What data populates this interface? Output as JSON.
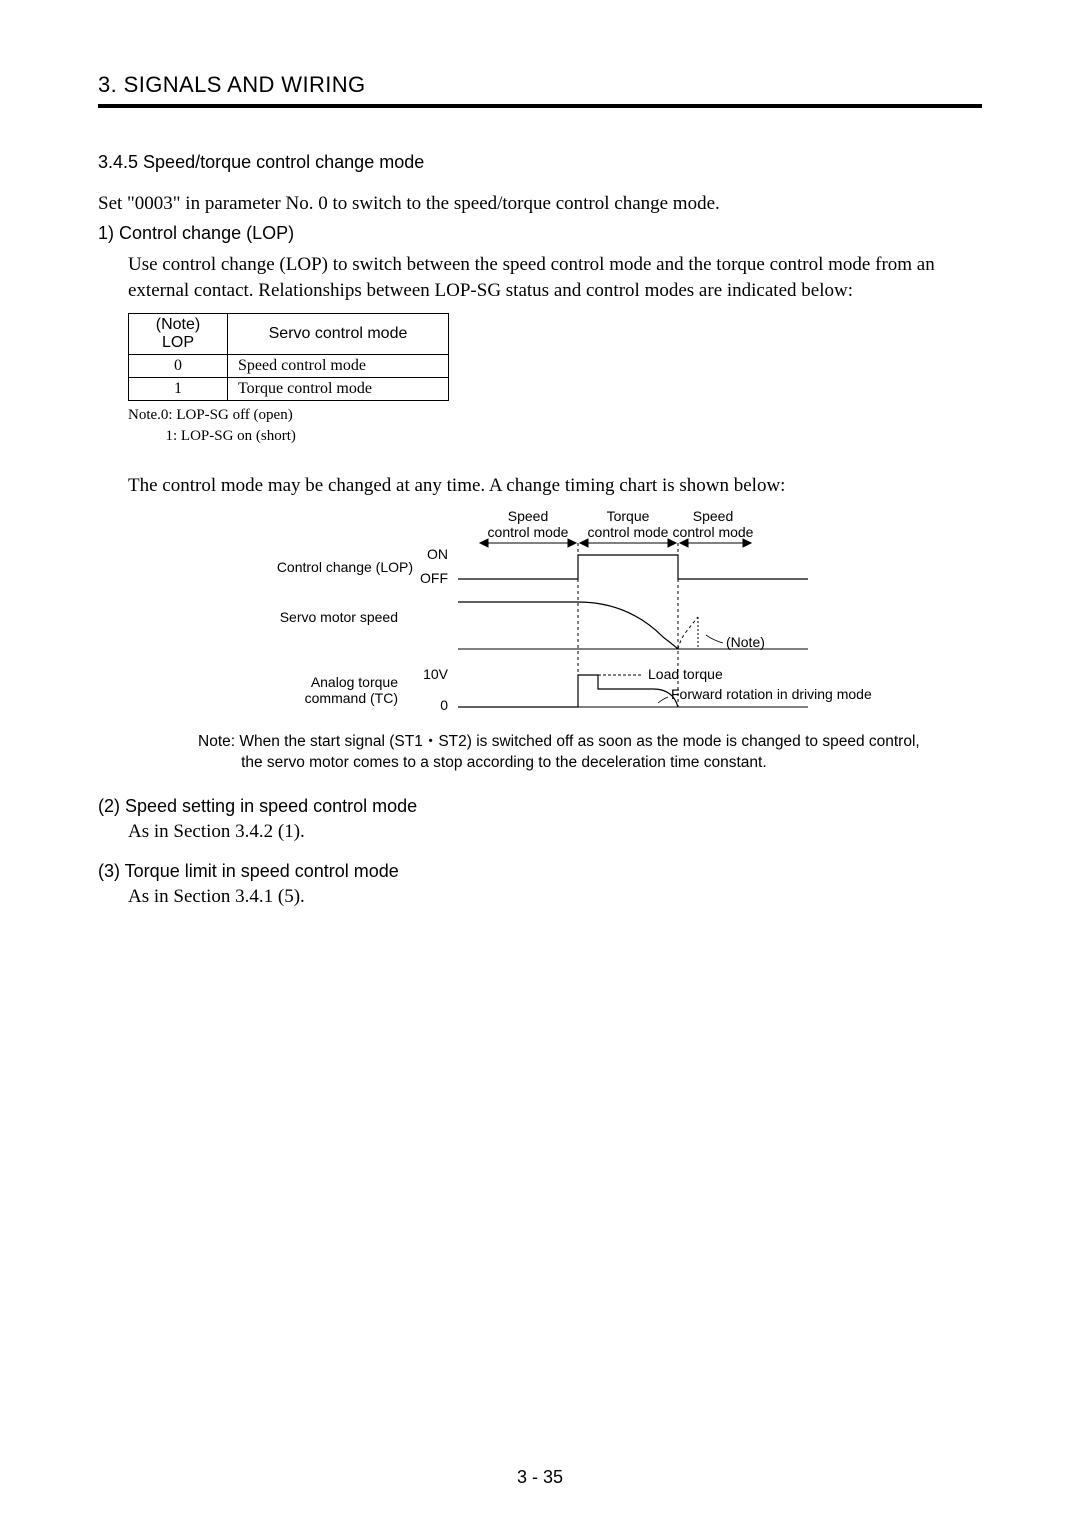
{
  "chapter_title": "3.  SIGNALS AND WIRING",
  "sec_no": "3.4.5 Speed/torque control change mode",
  "para_set": "Set \"0003\" in parameter No. 0 to switch to the speed/torque control change mode.",
  "sub1_title": "1) Control change (LOP)",
  "sub1_body": "Use control change (LOP) to switch between the speed control mode and the torque control mode from an external contact. Relationships between LOP-SG status and control modes are indicated below:",
  "table": {
    "h1": "(Note) LOP",
    "h2": "Servo control mode",
    "rows": [
      {
        "c0": "0",
        "c1": "Speed control mode"
      },
      {
        "c0": "1",
        "c1": "Torque control mode"
      }
    ],
    "note_line1": "Note.0: LOP-SG off (open)",
    "note_line2": "1: LOP-SG on (short)"
  },
  "para_change": "The control mode may be changed at any time. A change timing chart is shown below:",
  "chart": {
    "top_speed1": "Speed",
    "top_torque": "Torque",
    "top_speed2": "Speed",
    "top_cm1": "control mode",
    "top_cm2": "control mode",
    "top_cm3": "control mode",
    "lop_label": "Control change (LOP)",
    "on": "ON",
    "off": "OFF",
    "servo_label": "Servo motor speed",
    "note_label": "(Note)",
    "analog1": "Analog torque",
    "analog2": "command (TC)",
    "ten_v": "10V",
    "zero": "0",
    "load": "Load torque",
    "forward": "Forward rotation in driving mode"
  },
  "chart_note_line1": "Note: When the start signal (ST1・ST2) is switched off as soon as the mode is changed to speed control,",
  "chart_note_line2": "the servo motor comes to a stop according to the deceleration time constant.",
  "sub2_title": "(2) Speed setting in speed control mode",
  "sub2_body": "As in Section 3.4.2 (1).",
  "sub3_title": "(3) Torque limit in speed control mode",
  "sub3_body": "As in Section 3.4.1 (5).",
  "page_num": "3 -  35",
  "chart_data": {
    "type": "timing-diagram",
    "title": "Speed/torque control change timing chart",
    "signals": [
      {
        "name": "Control change (LOP)",
        "type": "digital",
        "levels": [
          "OFF",
          "ON"
        ],
        "segments": [
          {
            "phase": "Speed control mode",
            "level": "OFF"
          },
          {
            "phase": "Torque control mode",
            "level": "ON"
          },
          {
            "phase": "Speed control mode",
            "level": "OFF"
          }
        ]
      },
      {
        "name": "Servo motor speed",
        "type": "analog",
        "description": "Constant during speed mode; decays toward zero during torque mode; brief coast then stop on return to speed mode (see Note)"
      },
      {
        "name": "Analog torque command (TC)",
        "type": "analog",
        "range": [
          "0",
          "10V"
        ],
        "annotations": [
          "Load torque",
          "Forward rotation in driving mode"
        ],
        "description": "Rises from 0 to 10V at start of torque mode, steps down to load-torque level during torque mode, returns to 0 on exit"
      }
    ],
    "phase_boundaries": [
      "Speed control mode",
      "Torque control mode",
      "Speed control mode"
    ]
  }
}
